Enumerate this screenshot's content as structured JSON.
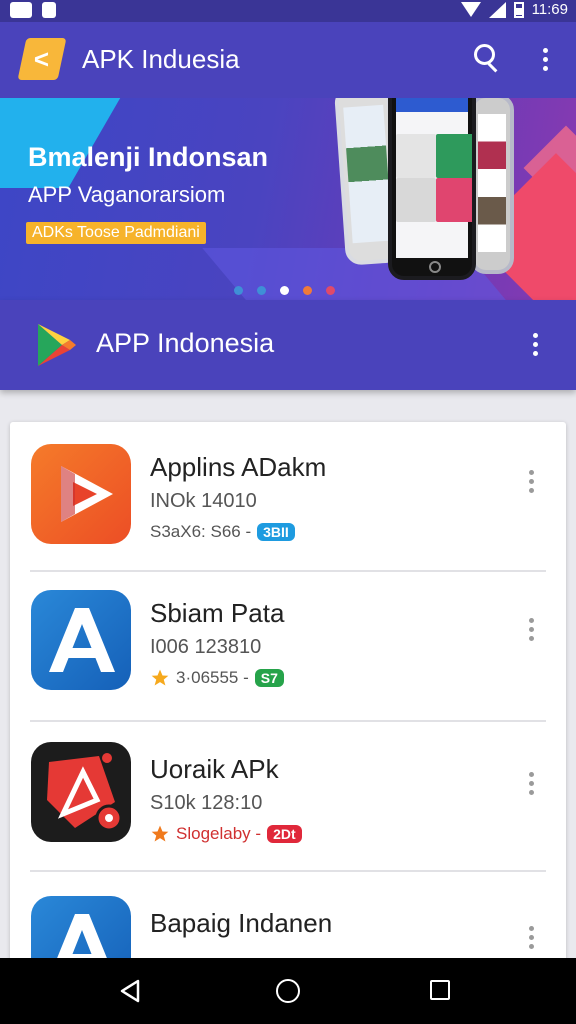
{
  "status_bar": {
    "time": "11:69"
  },
  "app_bar": {
    "title": "APK Induesia",
    "icons": [
      "apk-logo-icon",
      "search-icon",
      "more-vert-icon"
    ]
  },
  "banner": {
    "title": "Bmalenji Indonsan",
    "subtitle": "APP Vaganorarsiom",
    "badge": "ADKs Toose Padmdiani",
    "slides": 5,
    "active_slide": 3
  },
  "section": {
    "title": "APP Indonesia",
    "icons": [
      "play-store-icon",
      "more-vert-icon"
    ]
  },
  "apps": [
    {
      "name": "Applins ADakm",
      "meta": "INOk 14010",
      "rating": "S3aX6: S66 -",
      "tag": "3BII",
      "tag_color": "#1e9be0",
      "star": false,
      "icon": "orange-play-icon"
    },
    {
      "name": "Sbiam Pata",
      "meta": "I006 123810",
      "rating": "3·06555 -",
      "tag": "S7",
      "tag_color": "#26a34a",
      "star": true,
      "icon": "blue-a-icon"
    },
    {
      "name": "Uoraik APk",
      "meta": "S10k 128:10",
      "rating": "Slogelaby -",
      "tag": "2Dt",
      "tag_color": "#e0283a",
      "star": true,
      "icon": "red-shield-icon"
    },
    {
      "name": "Bapaig Indanen",
      "meta": "",
      "rating": "",
      "tag": "",
      "tag_color": "#1e9be0",
      "star": false,
      "icon": "blue-a-icon"
    }
  ],
  "colors": {
    "primary": "#4a43bb",
    "status_bar": "#3a3596",
    "accent_yellow": "#f6b32b",
    "star": "#f6a91d"
  }
}
